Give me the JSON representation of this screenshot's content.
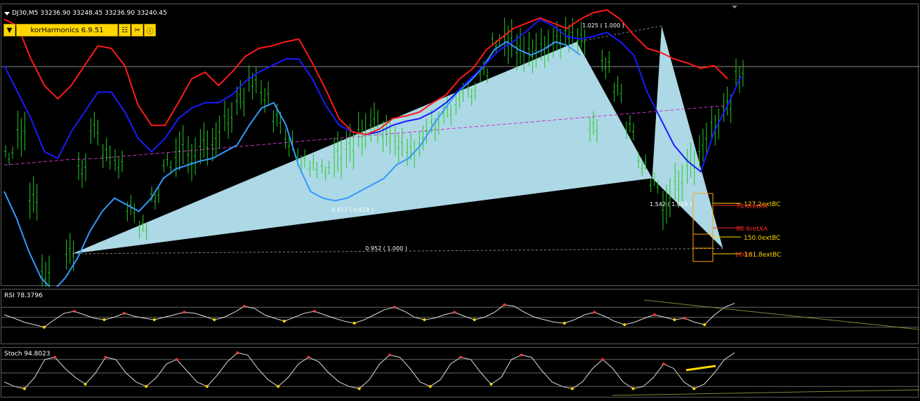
{
  "header": {
    "symbol": "DJ30,M5",
    "ohlc": "33236.90 33248.45 33236.90 33240.45"
  },
  "toolbar": {
    "indicator_name": "korHarmonics 6.9.51",
    "icons": [
      "dropdown-arrow-icon",
      "settings-sliders-icon",
      "tools-icon",
      "info-icon"
    ]
  },
  "colors": {
    "background": "#000000",
    "pattern_fill": "#add8e6",
    "bull_candle": "#22cc22",
    "upper_band": "#ff1a1a",
    "middle_band": "#1a1aff",
    "lower_band": "#3399ff",
    "ma": "#cc33cc",
    "accent": "#ffd700"
  },
  "ratios": {
    "r1": "0.612 ( 0.618 )",
    "r2": "0.952 ( 1.000 )",
    "r3": "1.025 ( 1.000 )",
    "r4": "1.542 ( 1.618 )"
  },
  "levels": {
    "l1": "127.2extBC",
    "l2": "78.6retXA",
    "l3": "88.6retXA",
    "l4": "150.0extBC",
    "l5": "100.0",
    "l6": "161.8extBC"
  },
  "rsi": {
    "label": "RSI 78.3796"
  },
  "stoch": {
    "label": "Stoch 94.8023"
  },
  "chart_data": [
    {
      "type": "line",
      "name": "price",
      "candles_close": [
        33180,
        33200,
        33150,
        33090,
        33050,
        33110,
        33170,
        33200,
        33185,
        33175,
        33140,
        33130,
        33150,
        33175,
        33185,
        33180,
        33190,
        33195,
        33210,
        33225,
        33235,
        33228,
        33210,
        33190,
        33180,
        33175,
        33170,
        33180,
        33190,
        33198,
        33205,
        33200,
        33190,
        33185,
        33195,
        33205,
        33215,
        33225,
        33230,
        33245,
        33265,
        33270,
        33262,
        33258,
        33265,
        33270,
        33272,
        33268,
        33205,
        33250,
        33230,
        33205,
        33175,
        33160,
        33145,
        33160,
        33175,
        33190,
        33205,
        33220,
        33240
      ],
      "bands_upper": [
        33285,
        33280,
        33255,
        33235,
        33225,
        33235,
        33250,
        33265,
        33263,
        33250,
        33220,
        33205,
        33205,
        33222,
        33240,
        33245,
        33235,
        33245,
        33257,
        33263,
        33265,
        33268,
        33270,
        33252,
        33232,
        33210,
        33200,
        33198,
        33202,
        33210,
        33212,
        33215,
        33222,
        33228,
        33240,
        33248,
        33262,
        33270,
        33278,
        33282,
        33286,
        33282,
        33278,
        33285,
        33290,
        33292,
        33285,
        33273,
        33263,
        33260,
        33255,
        33252,
        33248,
        33250,
        33240
      ],
      "bands_middle": [
        33250,
        33230,
        33210,
        33185,
        33180,
        33200,
        33215,
        33230,
        33230,
        33215,
        33195,
        33185,
        33195,
        33210,
        33218,
        33222,
        33222,
        33228,
        33238,
        33245,
        33250,
        33255,
        33255,
        33240,
        33220,
        33205,
        33200,
        33198,
        33200,
        33205,
        33208,
        33210,
        33215,
        33222,
        33232,
        33242,
        33252,
        33262,
        33268,
        33276,
        33285,
        33280,
        33272,
        33270,
        33272,
        33275,
        33268,
        33258,
        33230,
        33210,
        33190,
        33178,
        33170,
        33200,
        33220,
        33242
      ],
      "bands_lower": [
        33155,
        33135,
        33110,
        33090,
        33080,
        33090,
        33105,
        33125,
        33140,
        33150,
        33145,
        33140,
        33150,
        33165,
        33172,
        33175,
        33178,
        33180,
        33185,
        33190,
        33205,
        33218,
        33222,
        33205,
        33175,
        33155,
        33150,
        33148,
        33150,
        33155,
        33160,
        33165,
        33175,
        33180,
        33190,
        33205,
        33218,
        33230,
        33238,
        33248,
        33262,
        33268,
        33262,
        33258,
        33262,
        33268,
        33265,
        33258
      ],
      "ma": [
        33175,
        33177,
        33179,
        33180,
        33182,
        33184,
        33186,
        33188,
        33190,
        33192,
        33194,
        33196,
        33198,
        33200,
        33202,
        33204,
        33206,
        33208,
        33210,
        33212,
        33214,
        33216,
        33218,
        33220
      ],
      "ylim": [
        33090,
        33290
      ]
    },
    {
      "type": "line",
      "name": "harmonic_pattern",
      "points": {
        "X": [
          0.075,
          33108
        ],
        "A": [
          0.61,
          33268
        ],
        "B": [
          0.69,
          33165
        ],
        "C": [
          0.7,
          33280
        ],
        "D": [
          0.765,
          33112
        ]
      },
      "ratios": [
        "0.612 ( 0.618 )",
        "0.952 ( 1.000 )",
        "1.025 ( 1.000 )",
        "1.542 ( 1.618 )"
      ],
      "levels": [
        "127.2extBC",
        "78.6retXA",
        "88.6retXA",
        "150.0extBC",
        "100.0",
        "161.8extBC"
      ]
    },
    {
      "type": "line",
      "name": "RSI",
      "title": "RSI 78.3796",
      "values": [
        55,
        48,
        40,
        35,
        30,
        45,
        58,
        62,
        55,
        48,
        45,
        50,
        58,
        52,
        48,
        45,
        50,
        55,
        60,
        58,
        52,
        45,
        50,
        60,
        72,
        68,
        55,
        48,
        42,
        50,
        58,
        62,
        55,
        48,
        42,
        38,
        45,
        55,
        65,
        70,
        62,
        50,
        45,
        48,
        55,
        60,
        52,
        45,
        50,
        60,
        75,
        72,
        60,
        50,
        45,
        40,
        38,
        45,
        55,
        60,
        52,
        42,
        35,
        40,
        48,
        55,
        50,
        45,
        48,
        40,
        35,
        55,
        70,
        78
      ],
      "ylim": [
        0,
        100
      ]
    },
    {
      "type": "line",
      "name": "Stoch",
      "title": "Stoch 94.8023",
      "values": [
        30,
        20,
        15,
        40,
        80,
        85,
        60,
        40,
        25,
        50,
        85,
        80,
        50,
        30,
        20,
        40,
        70,
        80,
        55,
        30,
        20,
        45,
        75,
        95,
        90,
        60,
        35,
        20,
        40,
        70,
        85,
        75,
        50,
        30,
        20,
        15,
        35,
        70,
        90,
        85,
        60,
        30,
        20,
        35,
        70,
        85,
        80,
        50,
        25,
        40,
        80,
        90,
        85,
        55,
        30,
        20,
        15,
        30,
        60,
        80,
        60,
        30,
        15,
        20,
        40,
        70,
        60,
        30,
        15,
        25,
        50,
        80,
        95
      ],
      "ylim": [
        0,
        100
      ]
    }
  ]
}
